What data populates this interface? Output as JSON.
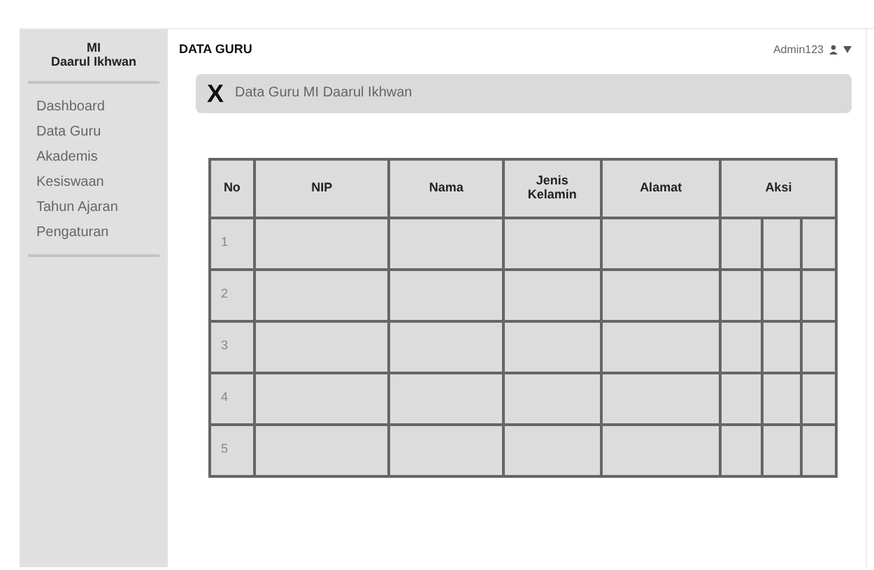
{
  "sidebar": {
    "title": "MI\nDaarul Ikhwan",
    "items": [
      "Dashboard",
      "Data Guru",
      "Akademis",
      "Kesiswaan",
      "Tahun Ajaran",
      "Pengaturan"
    ]
  },
  "header": {
    "title": "DATA GURU",
    "user": "Admin123"
  },
  "banner": {
    "icon": "X",
    "text": "Data Guru MI Daarul Ikhwan"
  },
  "table": {
    "columns": [
      "No",
      "NIP",
      "Nama",
      "Jenis\nKelamin",
      "Alamat",
      "Aksi"
    ],
    "rows": [
      {
        "no": "1"
      },
      {
        "no": "2"
      },
      {
        "no": "3"
      },
      {
        "no": "4"
      },
      {
        "no": "5"
      }
    ]
  }
}
